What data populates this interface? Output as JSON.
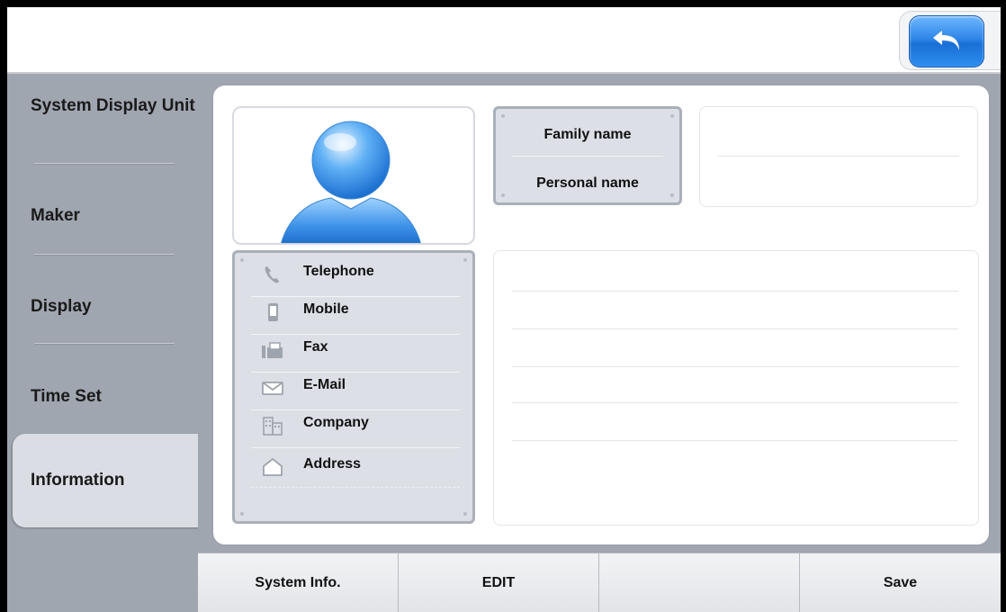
{
  "sidebar": {
    "items": [
      {
        "label": "System Display Unit"
      },
      {
        "label": "Maker"
      },
      {
        "label": "Display"
      },
      {
        "label": "Time Set"
      },
      {
        "label": "Information"
      }
    ],
    "active": "Information"
  },
  "profile": {
    "name_fields": {
      "family_label": "Family name",
      "personal_label": "Personal name",
      "family_value": "",
      "personal_value": ""
    },
    "contact_fields": [
      {
        "label": "Telephone",
        "icon": "telephone-icon",
        "value": ""
      },
      {
        "label": "Mobile",
        "icon": "mobile-icon",
        "value": ""
      },
      {
        "label": "Fax",
        "icon": "fax-icon",
        "value": ""
      },
      {
        "label": "E-Mail",
        "icon": "email-icon",
        "value": ""
      },
      {
        "label": "Company",
        "icon": "company-icon",
        "value": ""
      },
      {
        "label": "Address",
        "icon": "address-icon",
        "value": ""
      }
    ]
  },
  "bottom_bar": {
    "buttons": [
      "System Info.",
      "EDIT",
      "",
      "Save"
    ]
  },
  "colors": {
    "accent_blue": "#2f86e8",
    "sidebar_bg": "#a0a6b0",
    "active_tab_bg": "#dadde3"
  }
}
